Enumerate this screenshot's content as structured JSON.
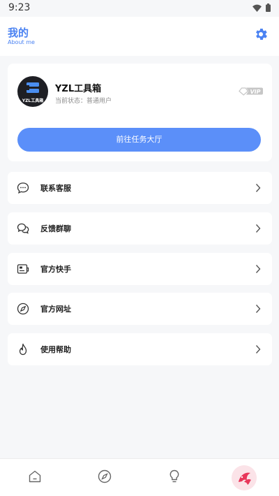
{
  "status_bar": {
    "time": "9:23"
  },
  "header": {
    "title": "我的",
    "subtitle": "About me"
  },
  "profile": {
    "name": "YZL工具箱",
    "status": "当前状态：普通用户",
    "avatar_label": "YZL工具箱",
    "badge": "VIP",
    "task_button": "前往任务大厅"
  },
  "menu": [
    {
      "label": "联系客服",
      "icon": "chat-bubble-icon"
    },
    {
      "label": "反馈群聊",
      "icon": "group-chat-icon"
    },
    {
      "label": "官方快手",
      "icon": "video-card-icon"
    },
    {
      "label": "官方网址",
      "icon": "compass-icon"
    },
    {
      "label": "使用帮助",
      "icon": "flame-icon"
    }
  ],
  "bottom_nav": [
    {
      "name": "home",
      "icon": "home-icon"
    },
    {
      "name": "discover",
      "icon": "compass-icon"
    },
    {
      "name": "ideas",
      "icon": "lightbulb-icon"
    },
    {
      "name": "profile",
      "icon": "avatar"
    }
  ],
  "colors": {
    "accent": "#4a82f2",
    "button": "#5b8ff9",
    "background": "#f6f7f9"
  }
}
